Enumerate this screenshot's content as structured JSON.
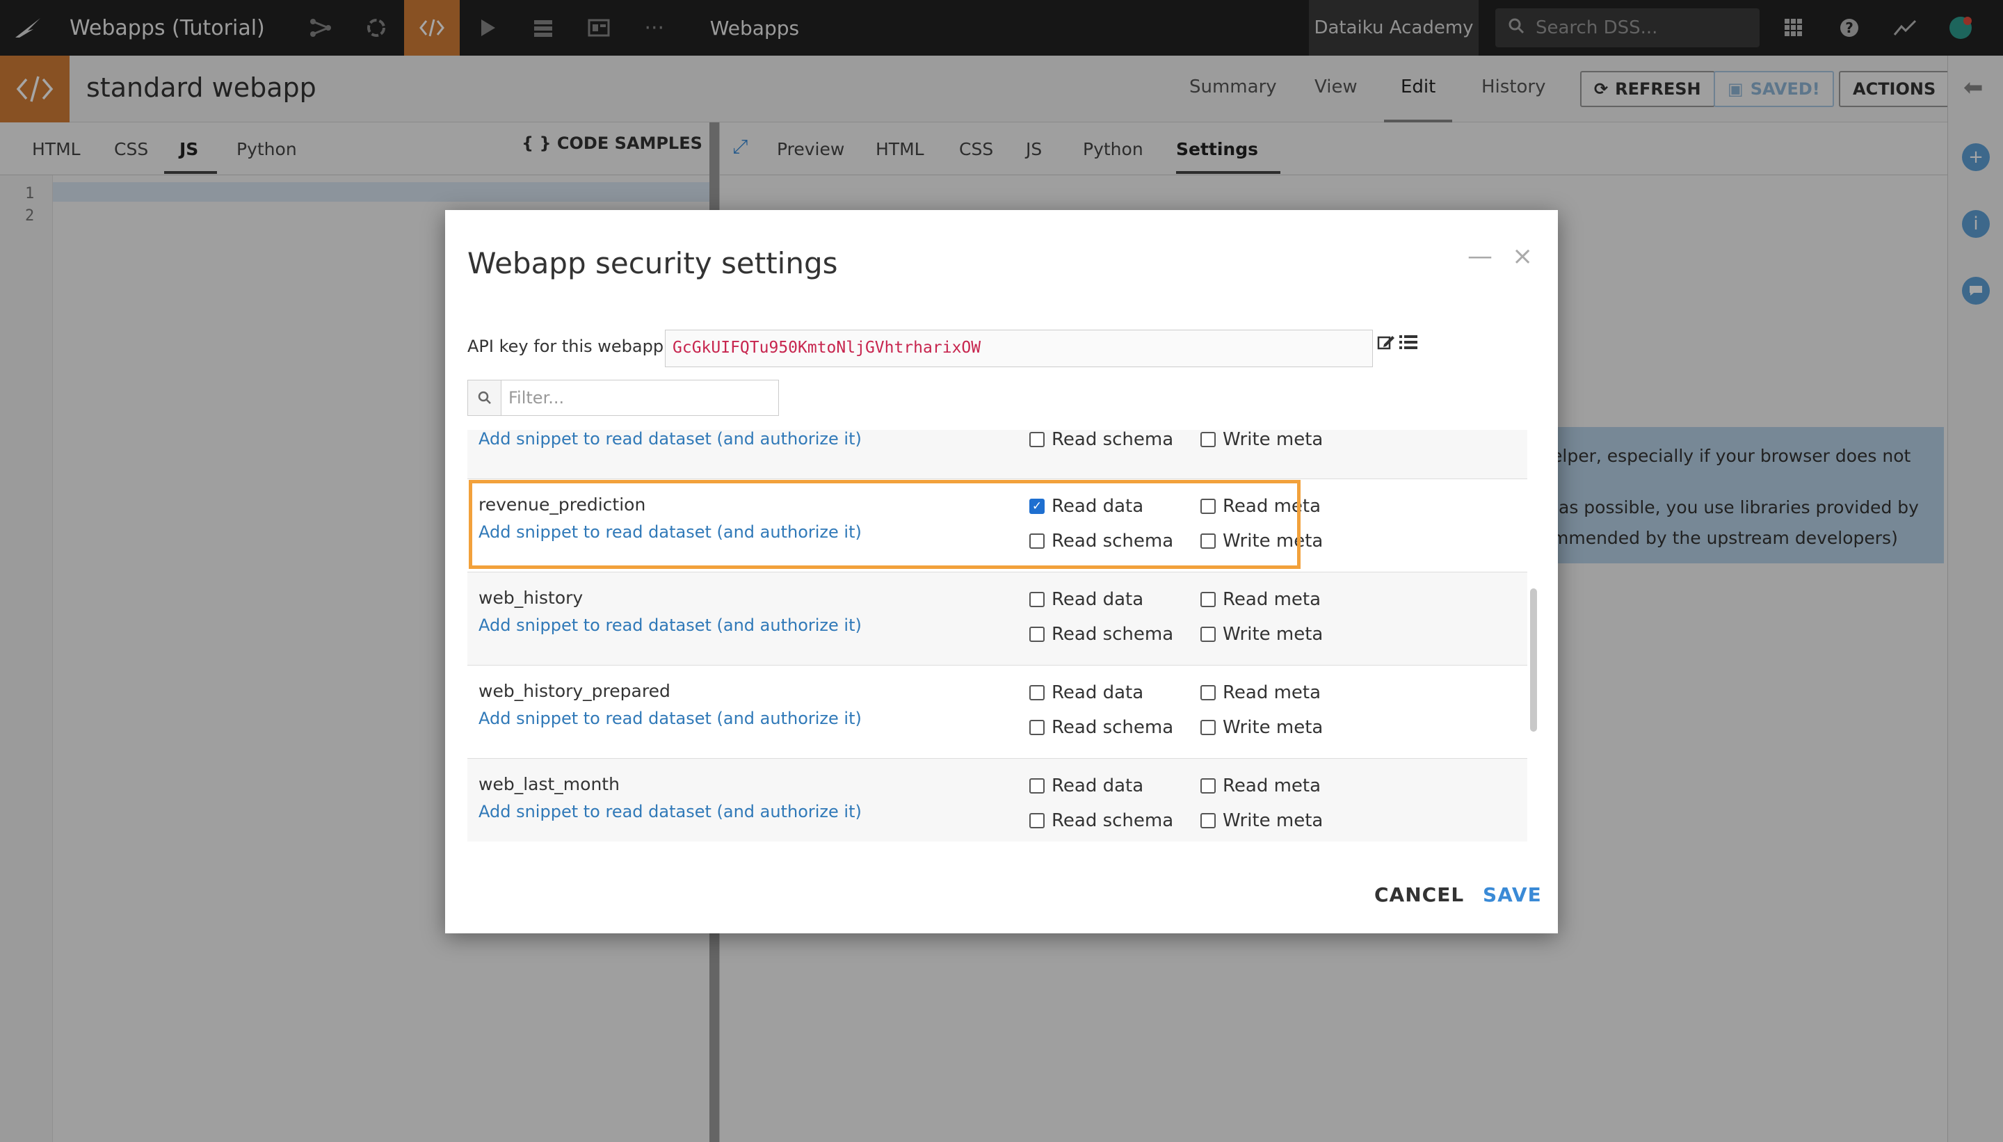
{
  "topnav": {
    "project_title": "Webapps (Tutorial)",
    "section": "Webapps",
    "academy": "Dataiku Academy",
    "search_placeholder": "Search DSS..."
  },
  "header": {
    "title": "standard webapp",
    "tabs": [
      "Summary",
      "View",
      "Edit",
      "History"
    ],
    "active_tab": "Edit",
    "refresh_label": "REFRESH",
    "saved_label": "SAVED!",
    "actions_label": "ACTIONS"
  },
  "editor": {
    "tabs": [
      "HTML",
      "CSS",
      "JS",
      "Python"
    ],
    "active_tab": "JS",
    "code_samples_label": "CODE SAMPLES",
    "line_numbers": [
      "1",
      "2"
    ]
  },
  "preview": {
    "tabs": [
      "Preview",
      "HTML",
      "CSS",
      "JS",
      "Python",
      "Settings"
    ],
    "active_tab": "Settings",
    "info_lines": [
      "elper, especially if your browser does not",
      "as possible, you use libraries provided by",
      "mmended by the upstream developers)"
    ]
  },
  "modal": {
    "title": "Webapp security settings",
    "api_key_label": "API key for this webapp:",
    "api_key": "GcGkUIFQTu950KmtoNljGVhtrharixOW",
    "filter_placeholder": "Filter...",
    "snippet_link": "Add snippet to read dataset (and authorize it)",
    "perm_labels": {
      "read_data": "Read data",
      "read_meta": "Read meta",
      "read_schema": "Read schema",
      "write_meta": "Write meta"
    },
    "partial_row": {
      "name": "",
      "read_schema": false,
      "write_meta": false
    },
    "datasets": [
      {
        "name": "revenue_prediction",
        "read_data": true,
        "read_meta": false,
        "read_schema": false,
        "write_meta": false
      },
      {
        "name": "web_history",
        "read_data": false,
        "read_meta": false,
        "read_schema": false,
        "write_meta": false
      },
      {
        "name": "web_history_prepared",
        "read_data": false,
        "read_meta": false,
        "read_schema": false,
        "write_meta": false
      },
      {
        "name": "web_last_month",
        "read_data": false,
        "read_meta": false,
        "read_schema": false,
        "write_meta": false
      }
    ],
    "cancel_label": "CANCEL",
    "save_label": "SAVE"
  },
  "colors": {
    "accent_orange": "#d27d36",
    "highlight_orange": "#f2a13b",
    "link_blue": "#3079b8",
    "api_key_red": "#c7254e"
  }
}
